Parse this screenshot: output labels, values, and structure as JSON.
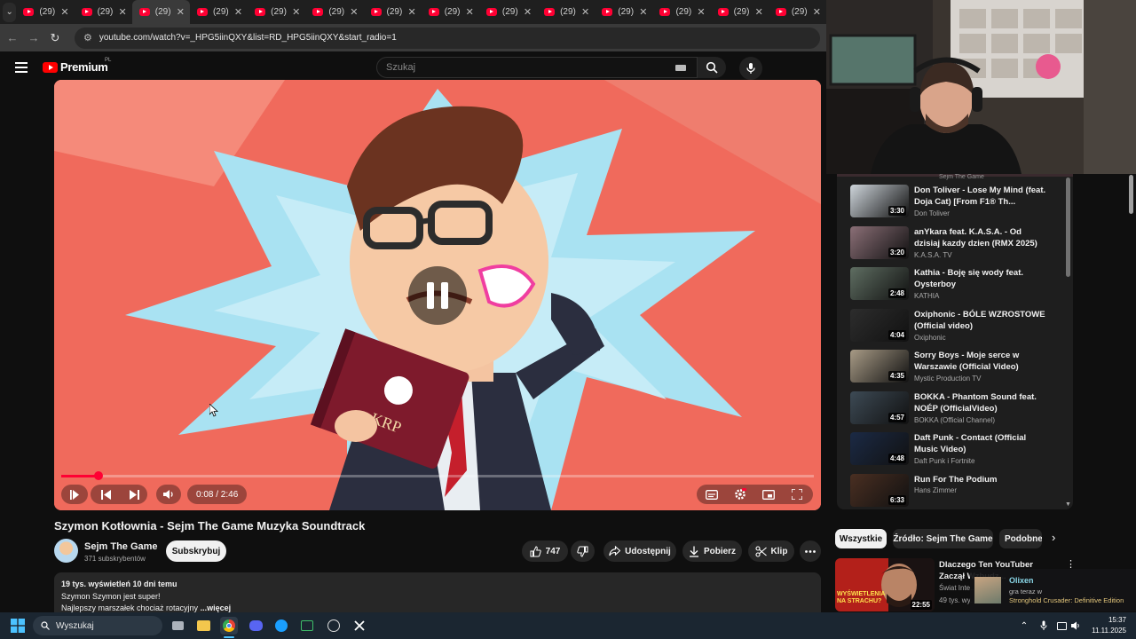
{
  "browser": {
    "tab_label": "(29)",
    "tab_count": 14,
    "active_tab_index": 2,
    "url": "youtube.com/watch?v=_HPG5iinQXY&list=RD_HPG5iinQXY&start_radio=1"
  },
  "header": {
    "logo_text": "Premium",
    "country_code": "PL",
    "search_placeholder": "Szukaj"
  },
  "player": {
    "time": "0:08 / 2:46",
    "progress_fraction": 0.05,
    "state": "paused-overlay"
  },
  "video": {
    "title": "Szymon Kotłownia - Sejm The Game Muzyka Soundtrack",
    "channel": "Sejm The Game",
    "subscribers": "371 subskrybentów",
    "subscribe_label": "Subskrybuj",
    "likes": "747",
    "share_label": "Udostępnij",
    "download_label": "Pobierz",
    "clip_label": "Klip",
    "description_meta": "19 tys. wyświetleń  10 dni temu",
    "description_line1": "Szymon Szymon jest super!",
    "description_line2": "Najlepszy marszałek chociaż rotacyjny",
    "description_more": "...więcej"
  },
  "playlist": {
    "top_text": "Sejm The Game",
    "items": [
      {
        "title": "Don Toliver - Lose My Mind (feat. Doja Cat) [From F1® Th...",
        "artist": "Don Toliver",
        "duration": "3:30",
        "color": "#cfd6dc"
      },
      {
        "title": "anYkara feat. K.A.S.A. - Od dzisiaj kazdy dzien (RMX 2025)",
        "artist": "K.A.S.A. TV",
        "duration": "3:20",
        "color": "#8b6f77"
      },
      {
        "title": "Kathia - Boję się wody feat. Oysterboy",
        "artist": "KATHIA",
        "duration": "2:48",
        "color": "#5f6e62"
      },
      {
        "title": "Oxiphonic - BÓLE WZROSTOWE (Official video)",
        "artist": "Oxiphonic",
        "duration": "4:04",
        "color": "#2d2d2d"
      },
      {
        "title": "Sorry Boys - Moje serce w Warszawie (Official Video)",
        "artist": "Mystic Production TV",
        "duration": "4:35",
        "color": "#a89b86"
      },
      {
        "title": "BOKKA - Phantom Sound feat. NOÉP (OfficialVideo)",
        "artist": "BOKKA (Official Channel)",
        "duration": "4:57",
        "color": "#3d4a55"
      },
      {
        "title": "Daft Punk - Contact (Official Music Video)",
        "artist": "Daft Punk i Fortnite",
        "duration": "4:48",
        "color": "#1b2a45"
      },
      {
        "title": "Run For The Podium",
        "artist": "Hans Zimmer",
        "duration": "6:33",
        "color": "#4a2f22"
      }
    ]
  },
  "chips": [
    "Wszystkie",
    "Źródło: Sejm The Game",
    "Podobne"
  ],
  "recommended": {
    "title": "Dlaczego Ten YouTuber Zaczął Wzbudz...",
    "channel": "Świat Inte...",
    "views": "49 tys. wy...",
    "duration": "22:55",
    "thumb_text": "WYŚWIETLENIA NA STRACHU?"
  },
  "notification": {
    "name": "Olixen",
    "line": "gra teraz w",
    "game": "Stronghold Crusader: Definitive Edition"
  },
  "taskbar": {
    "search_label": "Wyszukaj",
    "time": "15:37",
    "date": "11.11.2025"
  }
}
